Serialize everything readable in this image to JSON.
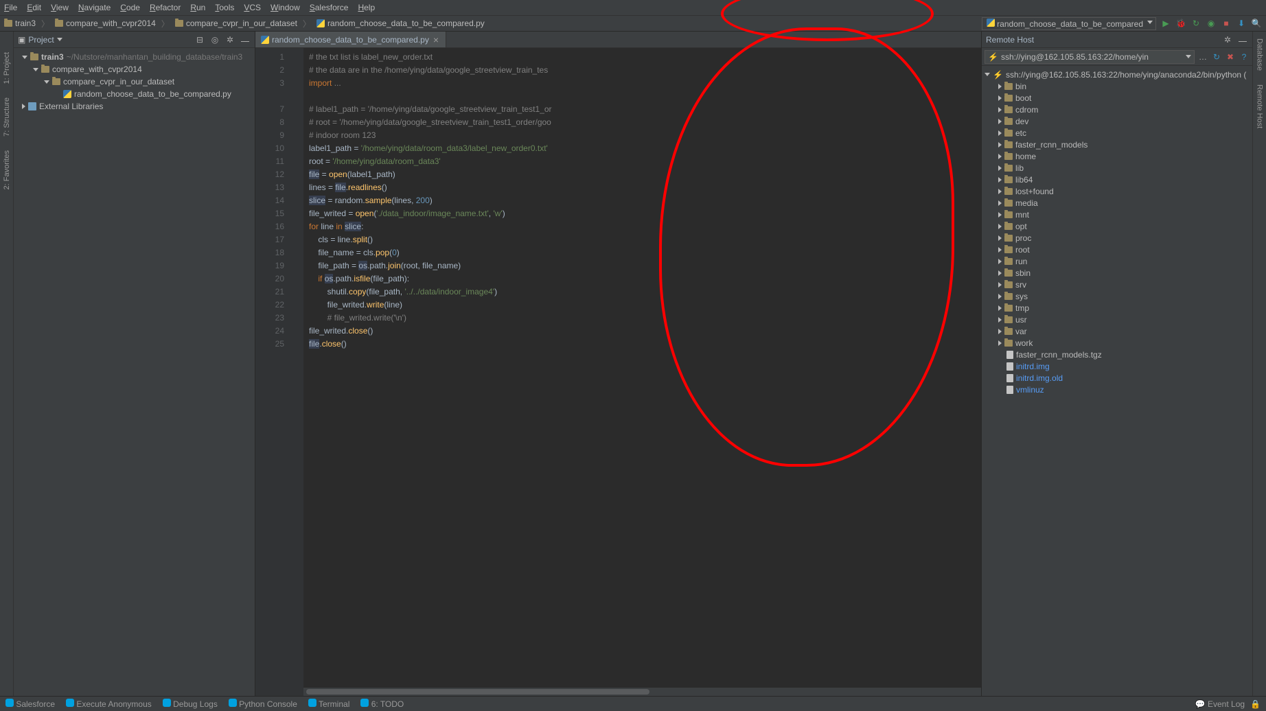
{
  "menubar": [
    "File",
    "Edit",
    "View",
    "Navigate",
    "Code",
    "Refactor",
    "Run",
    "Tools",
    "VCS",
    "Window",
    "Salesforce",
    "Help"
  ],
  "breadcrumbs": [
    {
      "icon": "folder",
      "label": "train3"
    },
    {
      "icon": "folder",
      "label": "compare_with_cvpr2014"
    },
    {
      "icon": "folder",
      "label": "compare_cvpr_in_our_dataset"
    },
    {
      "icon": "py",
      "label": "random_choose_data_to_be_compared.py"
    }
  ],
  "run_config": "random_choose_data_to_be_compared",
  "project_panel": {
    "title": "Project",
    "tree": [
      {
        "depth": 0,
        "arrow": "down",
        "icon": "folder",
        "label": "train3",
        "dim": "~/Nutstore/manhantan_building_database/train3",
        "bold": true
      },
      {
        "depth": 1,
        "arrow": "down",
        "icon": "folder",
        "label": "compare_with_cvpr2014"
      },
      {
        "depth": 2,
        "arrow": "down",
        "icon": "folder",
        "label": "compare_cvpr_in_our_dataset"
      },
      {
        "depth": 3,
        "arrow": "",
        "icon": "py",
        "label": "random_choose_data_to_be_compared.py"
      },
      {
        "depth": 0,
        "arrow": "right",
        "icon": "lib",
        "label": "External Libraries"
      }
    ]
  },
  "editor_tab": "random_choose_data_to_be_compared.py",
  "editor_lines": [
    "1",
    "2",
    "3",
    "",
    "7",
    "8",
    "9",
    "10",
    "11",
    "12",
    "13",
    "14",
    "15",
    "16",
    "17",
    "18",
    "19",
    "20",
    "21",
    "22",
    "23",
    "24",
    "25"
  ],
  "code_lines": [
    {
      "t": "cmt",
      "s": "# the txt list is label_new_order.txt"
    },
    {
      "t": "cmt",
      "s": "# the data are in the /home/ying/data/google_streetview_train_tes"
    },
    {
      "t": "imp",
      "s": "import ..."
    },
    {
      "t": "blank",
      "s": ""
    },
    {
      "t": "cmt",
      "s": "# label1_path = '/home/ying/data/google_streetview_train_test1_or"
    },
    {
      "t": "cmt",
      "s": "# root = '/home/ying/data/google_streetview_train_test1_order/goo"
    },
    {
      "t": "cmt",
      "s": "# indoor room 123"
    },
    {
      "t": "code",
      "s": "label1_path = '/home/ying/data/room_data3/label_new_order0.txt'"
    },
    {
      "t": "code",
      "s": "root = '/home/ying/data/room_data3'"
    },
    {
      "t": "code",
      "s": "file = open(label1_path)"
    },
    {
      "t": "code",
      "s": "lines = file.readlines()"
    },
    {
      "t": "code",
      "s": "slice = random.sample(lines, 200)"
    },
    {
      "t": "code",
      "s": "file_writed = open('./data_indoor/image_name.txt', 'w')"
    },
    {
      "t": "code",
      "s": "for line in slice:"
    },
    {
      "t": "code",
      "s": "    cls = line.split()"
    },
    {
      "t": "code",
      "s": "    file_name = cls.pop(0)"
    },
    {
      "t": "code",
      "s": "    file_path = os.path.join(root, file_name)"
    },
    {
      "t": "code",
      "s": "    if os.path.isfile(file_path):"
    },
    {
      "t": "code",
      "s": "        shutil.copy(file_path, '../../data/indoor_image4')"
    },
    {
      "t": "code",
      "s": "        file_writed.write(line)"
    },
    {
      "t": "cmt",
      "s": "        # file_writed.write('\\n')"
    },
    {
      "t": "code",
      "s": "file_writed.close()"
    },
    {
      "t": "code",
      "s": "file.close()"
    }
  ],
  "remote": {
    "title": "Remote Host",
    "path": "ssh://ying@162.105.85.163:22/home/yin",
    "root": "ssh://ying@162.105.85.163:22/home/ying/anaconda2/bin/python (",
    "folders": [
      "bin",
      "boot",
      "cdrom",
      "dev",
      "etc",
      "faster_rcnn_models",
      "home",
      "lib",
      "lib64",
      "lost+found",
      "media",
      "mnt",
      "opt",
      "proc",
      "root",
      "run",
      "sbin",
      "srv",
      "sys",
      "tmp",
      "usr",
      "var",
      "work"
    ],
    "files": [
      {
        "name": "faster_rcnn_models.tgz",
        "link": false
      },
      {
        "name": "initrd.img",
        "link": true
      },
      {
        "name": "initrd.img.old",
        "link": true
      },
      {
        "name": "vmlinuz",
        "link": true
      }
    ]
  },
  "left_gutter": [
    "1: Project",
    "7: Structure",
    "2: Favorites"
  ],
  "right_gutter": [
    "Database",
    "Remote Host"
  ],
  "statusbar": {
    "left": [
      "Salesforce",
      "Execute Anonymous",
      "Debug Logs",
      "Python Console",
      "Terminal",
      "6: TODO"
    ],
    "right": "Event Log"
  }
}
